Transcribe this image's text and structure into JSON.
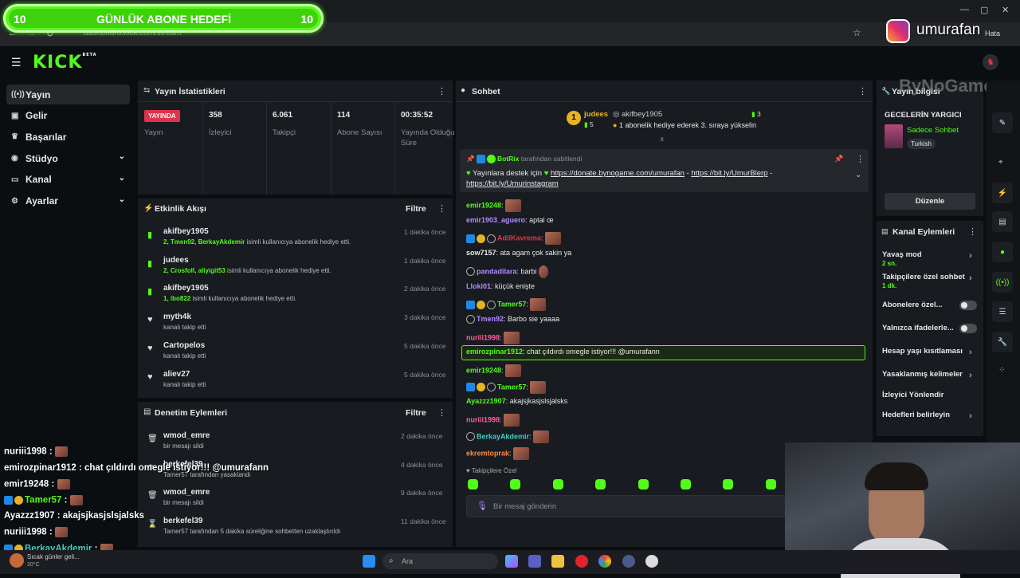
{
  "browser": {
    "url": "dashboard.kick.com/stream",
    "error_label": "Hata"
  },
  "goal": {
    "left": "10",
    "title": "GÜNLÜK ABONE HEDEFİ",
    "right": "10"
  },
  "instagram": {
    "handle": "umurafan"
  },
  "logo": {
    "text": "KICK",
    "beta": "BETA"
  },
  "sidebar": [
    {
      "icon": "broadcast-icon",
      "label": "Yayın",
      "active": true
    },
    {
      "icon": "income-icon",
      "label": "Gelir"
    },
    {
      "icon": "trophy-icon",
      "label": "Başarılar"
    },
    {
      "icon": "studio-icon",
      "label": "Stüdyo",
      "chevron": true
    },
    {
      "icon": "channel-icon",
      "label": "Kanal",
      "chevron": true
    },
    {
      "icon": "settings-icon",
      "label": "Ayarlar",
      "chevron": true
    }
  ],
  "stats": {
    "title": "Yayın İstatistikleri",
    "live_badge": "YAYINDA",
    "items": [
      {
        "value": "",
        "label": "Yayın"
      },
      {
        "value": "358",
        "label": "İzleyici"
      },
      {
        "value": "6.061",
        "label": "Takipçi"
      },
      {
        "value": "114",
        "label": "Abone Sayısı"
      },
      {
        "value": "00:35:52",
        "label": "Yayında Olduğu Süre"
      }
    ]
  },
  "activity": {
    "title": "Etkinlik Akışı",
    "filter": "Filtre",
    "items": [
      {
        "name": "akifbey1905",
        "sub_hl": "2, Tmen92, BerkayAkdemir",
        "sub": " isimli kullanıcıya abonelik hediye etti.",
        "time": "1 dakika önce",
        "kind": "gift"
      },
      {
        "name": "judees",
        "sub_hl": "2, Crosfoll, aliyigit53",
        "sub": " isimli kullanıcıya abonelik hediye etti.",
        "time": "1 dakika önce",
        "kind": "gift"
      },
      {
        "name": "akifbey1905",
        "sub_hl": "1, ibo822",
        "sub": " isimli kullanıcıya abonelik hediye etti.",
        "time": "2 dakika önce",
        "kind": "gift"
      },
      {
        "name": "myth4k",
        "sub_hl": "",
        "sub": "kanalı takip etti",
        "time": "3 dakika önce",
        "kind": "follow"
      },
      {
        "name": "Cartopelos",
        "sub_hl": "",
        "sub": "kanalı takip etti",
        "time": "5 dakika önce",
        "kind": "follow"
      },
      {
        "name": "aliev27",
        "sub_hl": "",
        "sub": "kanalı takip etti",
        "time": "5 dakika önce",
        "kind": "follow"
      }
    ]
  },
  "moderation": {
    "title": "Denetim Eylemleri",
    "filter": "Filtre",
    "items": [
      {
        "name": "wmod_emre",
        "sub": "bir mesajı sildi",
        "time": "2 dakika önce",
        "icon": "trash-icon"
      },
      {
        "name": "berkefel39",
        "sub": "Tamer57 tarafından yasaklandı",
        "time": "4 dakika önce",
        "icon": "ban-icon"
      },
      {
        "name": "wmod_emre",
        "sub": "bir mesajı sildi",
        "time": "9 dakika önce",
        "icon": "trash-icon"
      },
      {
        "name": "berkefel39",
        "sub": "Tamer57 tarafından 5 dakika süreliğine sohbetten uzaklaştırıldı",
        "time": "11 dakika önce",
        "icon": "hourglass-icon"
      }
    ]
  },
  "chat": {
    "title": "Sohbet",
    "gift_banner": {
      "user": "judees",
      "count": "5",
      "target": "akifbey1905",
      "amount": "3",
      "text": "1 abonelik hediye ederek 3. sıraya yükselin"
    },
    "pinned": {
      "by": "BotRix",
      "by_suffix": "tarafından sabitlendi",
      "text": "Yayınlara destek için",
      "link1": "https://donate.bynogame.com/umurafan",
      "sep1": " - ",
      "link2": "https://bit.ly/UmurBlerp",
      "sep2": " - ",
      "link3": "https://bit.ly/Umurinstagram"
    },
    "messages": [
      {
        "user": "emir19248",
        "color": "#53fc18",
        "text": "",
        "emote": true
      },
      {
        "user": "emir1903_aguero",
        "color": "#b28cff",
        "text": "aptal œ"
      },
      {
        "user": "AdilKavrema",
        "color": "#e0334b",
        "text": "",
        "emote": true,
        "badges": true
      },
      {
        "user": "sow7157",
        "color": "#e6e8ea",
        "text": "ata agam çok sakin ya"
      },
      {
        "user": "pandadilara",
        "color": "#b28cff",
        "text": "barbi",
        "emote_small": true,
        "mod": true
      },
      {
        "user": "Lloki01",
        "color": "#b28cff",
        "text": "küçük enişte"
      },
      {
        "user": "Tamer57",
        "color": "#53fc18",
        "text": "",
        "emote": true,
        "badges": true
      },
      {
        "user": "Tmen92",
        "color": "#b28cff",
        "text": "Barbo sie yaaaa",
        "mod": true
      },
      {
        "user": "nuriii1998",
        "color": "#ff5e9a",
        "text": "",
        "emote": true
      },
      {
        "user": "emirozpinar1912",
        "color": "#53fc18",
        "text": "chat çıldırdı omegle istiyor!!! @umurafann",
        "highlight": true
      },
      {
        "user": "emir19248",
        "color": "#53fc18",
        "text": "",
        "emote": true
      },
      {
        "user": "Tamer57",
        "color": "#53fc18",
        "text": "",
        "emote": true,
        "badges": true
      },
      {
        "user": "Ayazzz1907",
        "color": "#53fc18",
        "text": "akajsjkasjslsjalsks"
      },
      {
        "user": "nuriii1998",
        "color": "#ff5e9a",
        "text": "",
        "emote": true
      },
      {
        "user": "BerkayAkdemir",
        "color": "#3fd0c9",
        "text": "",
        "emote": true,
        "mod": true
      },
      {
        "user": "ekremtoprak",
        "color": "#ff8a3d",
        "text": "",
        "emote": true
      }
    ],
    "emote_tab": "Takipçilere Özel",
    "input_placeholder": "Bir mesaj gönderin"
  },
  "stream_info": {
    "title": "Yayın bilgisi",
    "stream_title": "GECELERİN YARGICI",
    "category": "Sadece Sohbet",
    "tag": "Turkish",
    "edit_button": "Düzenle",
    "watermark": "ByNoGame"
  },
  "channel_actions": {
    "title": "Kanal Eylemleri",
    "items": [
      {
        "label": "Yavaş mod",
        "sub": "2 sn.",
        "type": "chevron"
      },
      {
        "label": "Takipçilere özel sohbet",
        "sub": "1 dk.",
        "type": "chevron"
      },
      {
        "label": "Abonelere özel...",
        "sub": "",
        "type": "toggle"
      },
      {
        "label": "Yalnızca ifadelerle...",
        "sub": "",
        "type": "toggle"
      },
      {
        "label": "Hesap yaşı kısıtlaması",
        "sub": "",
        "type": "chevron"
      },
      {
        "label": "Yasaklanmış kelimeler",
        "sub": "",
        "type": "chevron"
      },
      {
        "label": "İzleyici Yönlendir",
        "sub": "",
        "type": "none"
      },
      {
        "label": "Hedefleri belirleyin",
        "sub": "",
        "type": "chevron"
      }
    ]
  },
  "overlay_chat": [
    {
      "user": "nuriii1998",
      "color": "#fff",
      "text": "",
      "emote": true
    },
    {
      "user": "emirozpinar1912",
      "color": "#fff",
      "text": "chat çıldırdı omegle istiyor!!! @umurafann"
    },
    {
      "user": "emir19248",
      "color": "#fff",
      "text": "",
      "emote": true
    },
    {
      "user": "Tamer57",
      "color": "#53fc18",
      "text": "",
      "emote": true,
      "badges": true
    },
    {
      "user": "Ayazzz1907",
      "color": "#fff",
      "text": "akajsjkasjslsjalsks"
    },
    {
      "user": "nuriii1998",
      "color": "#fff",
      "text": "",
      "emote": true
    },
    {
      "user": "BerkayAkdemir",
      "color": "#3fd0c9",
      "text": "",
      "emote": true,
      "badges": true
    }
  ],
  "taskbar": {
    "search": "Ara",
    "weather_title": "Sıcak günler geli...",
    "weather_temp": "20°C"
  }
}
